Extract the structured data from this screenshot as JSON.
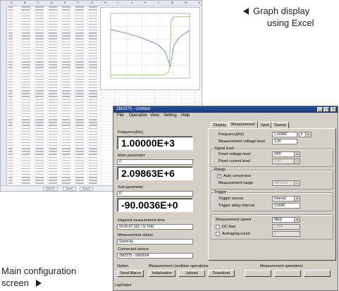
{
  "callouts": {
    "graph_line1": "Graph display",
    "graph_line2": "using Excel",
    "main_line1": "Main configuration",
    "main_line2": "screen"
  },
  "spreadsheet": {
    "columns": [
      "A",
      "B",
      "C",
      "D",
      "E",
      "F",
      "G",
      "H",
      "I",
      "J",
      "K",
      "L",
      "M",
      "N",
      "O"
    ],
    "sheet_tabs": [
      "ZM2375",
      "Sheet2",
      "Sheet3"
    ]
  },
  "chart_data": {
    "type": "line",
    "title": "",
    "xlabel": "",
    "ylabel": "",
    "x_scale": "log",
    "series": [
      {
        "name": "",
        "color": "#7a86b8",
        "points": [
          [
            10,
            0.01
          ],
          [
            100,
            0.006
          ],
          [
            1000,
            0.003
          ],
          [
            10000,
            0.0012
          ],
          [
            30000,
            0.0004
          ],
          [
            60000,
            5e-05
          ],
          [
            100000,
            0.001
          ],
          [
            200000,
            0.003
          ],
          [
            1000000,
            0.009
          ]
        ]
      },
      {
        "name": "",
        "color": "#9cc06a",
        "points": [
          [
            10,
            -90
          ],
          [
            10000,
            -90
          ],
          [
            30000,
            -89
          ],
          [
            50000,
            -80
          ],
          [
            60000,
            0
          ],
          [
            70000,
            80
          ],
          [
            100000,
            89
          ],
          [
            1000000,
            90
          ]
        ]
      }
    ]
  },
  "window": {
    "title": "ZM2375 - Untitled",
    "menu": [
      "File",
      "Operation",
      "View",
      "Setting",
      "Help"
    ],
    "left": {
      "freq_label": "Frequency[Hz]",
      "freq_value": "1.00000E+3",
      "main_label": "Main parameter",
      "main_code": "C",
      "main_value": "2.09863E+6",
      "sub_label": "Sub parameter",
      "sub_code": "D",
      "sub_value": "-90.0036E+0",
      "elapsed_label": "Elapsed measurement time",
      "elapsed_value": "00:00:07.322    (   0/  100)",
      "status_label": "Measurement status",
      "status_value": "Stand-by",
      "device_label": "Connected device",
      "device_value": "ZM2375 - 0000004"
    },
    "tabs": [
      "Display",
      "Measurement",
      "Spot",
      "Sweep"
    ],
    "right": {
      "frequency_label": "Frequency[Hz]",
      "frequency_value": "1.00000",
      "frequency_unit": "k",
      "voltage_label": "Measurement voltage level",
      "voltage_value": "1.00",
      "signal_group": "Signal level",
      "fixed_voltage_label": "Fixed voltage level",
      "fixed_voltage_value": "OFF",
      "fixed_current_label": "Fixed current level",
      "fixed_current_value": "1.00",
      "range_group": "Range",
      "auto_conv_label": "Auto conversion",
      "meas_range_label": "Measurement range",
      "meas_range_value": "1M Ohm",
      "trigger_group": "Trigger",
      "trigger_source_label": "Trigger source",
      "trigger_source_value": "Internal",
      "trigger_delay_label": "Trigger delay interval",
      "trigger_delay_value": "0.0000",
      "speed_label": "Measurement speed",
      "speed_value": "MED",
      "dc_bias_label": "DC bias",
      "dc_bias_value": "0.000",
      "averaging_label": "Averaging count",
      "averaging_value": "1"
    },
    "bottom": {
      "option_label": "Option",
      "cond_label": "Measurement condition operations",
      "ops_label": "Measurement operations",
      "send_macro": "Send Macro",
      "initialization": "Initialization",
      "upload": "Upload",
      "download": "Download",
      "log_label": "LogOutput"
    }
  }
}
